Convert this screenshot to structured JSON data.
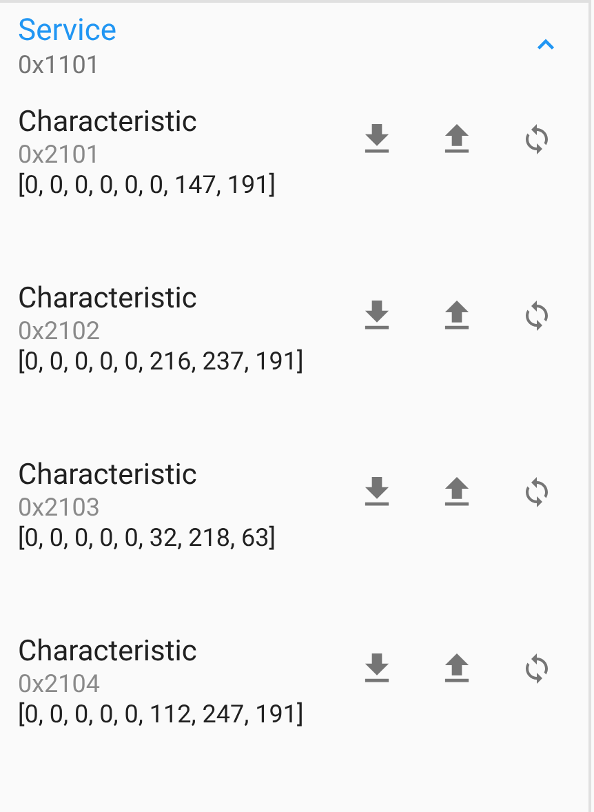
{
  "service": {
    "title": "Service",
    "uuid": "0x1101",
    "expanded": true
  },
  "characteristics": [
    {
      "title": "Characteristic",
      "uuid": "0x2101",
      "value": "[0, 0, 0, 0, 0, 0, 147, 191]"
    },
    {
      "title": "Characteristic",
      "uuid": "0x2102",
      "value": "[0, 0, 0, 0, 0, 216, 237, 191]"
    },
    {
      "title": "Characteristic",
      "uuid": "0x2103",
      "value": "[0, 0, 0, 0, 0, 32, 218, 63]"
    },
    {
      "title": "Characteristic",
      "uuid": "0x2104",
      "value": "[0, 0, 0, 0, 0, 112, 247, 191]"
    }
  ]
}
